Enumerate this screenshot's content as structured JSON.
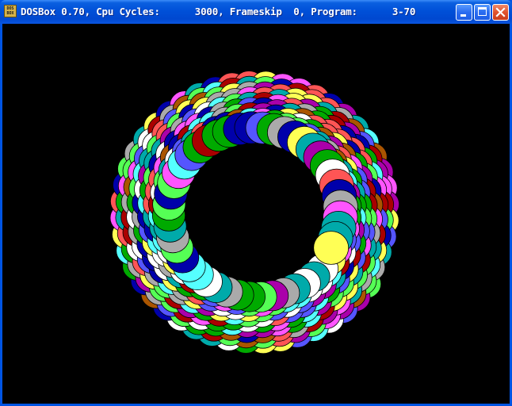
{
  "window": {
    "title": "DOSBox 0.70, Cpu Cycles:      3000, Frameskip  0, Program:      3-70",
    "app_icon_text": "DOS BOX",
    "frame_color": "#0054e3",
    "close_color": "#e0532e"
  },
  "titlebar_buttons": [
    {
      "name": "minimize-button",
      "icon": "minimize-icon"
    },
    {
      "name": "maximize-button",
      "icon": "maximize-icon"
    },
    {
      "name": "close-button",
      "icon": "close-icon"
    }
  ],
  "screen": {
    "background": "#000000",
    "palette": [
      "#0000aa",
      "#00aa00",
      "#00aaaa",
      "#aa0000",
      "#aa00aa",
      "#aa5500",
      "#aaaaaa",
      "#5555ff",
      "#55ff55",
      "#55ffff",
      "#ff5555",
      "#ff55ff",
      "#ffff55",
      "#ffffff"
    ]
  }
}
